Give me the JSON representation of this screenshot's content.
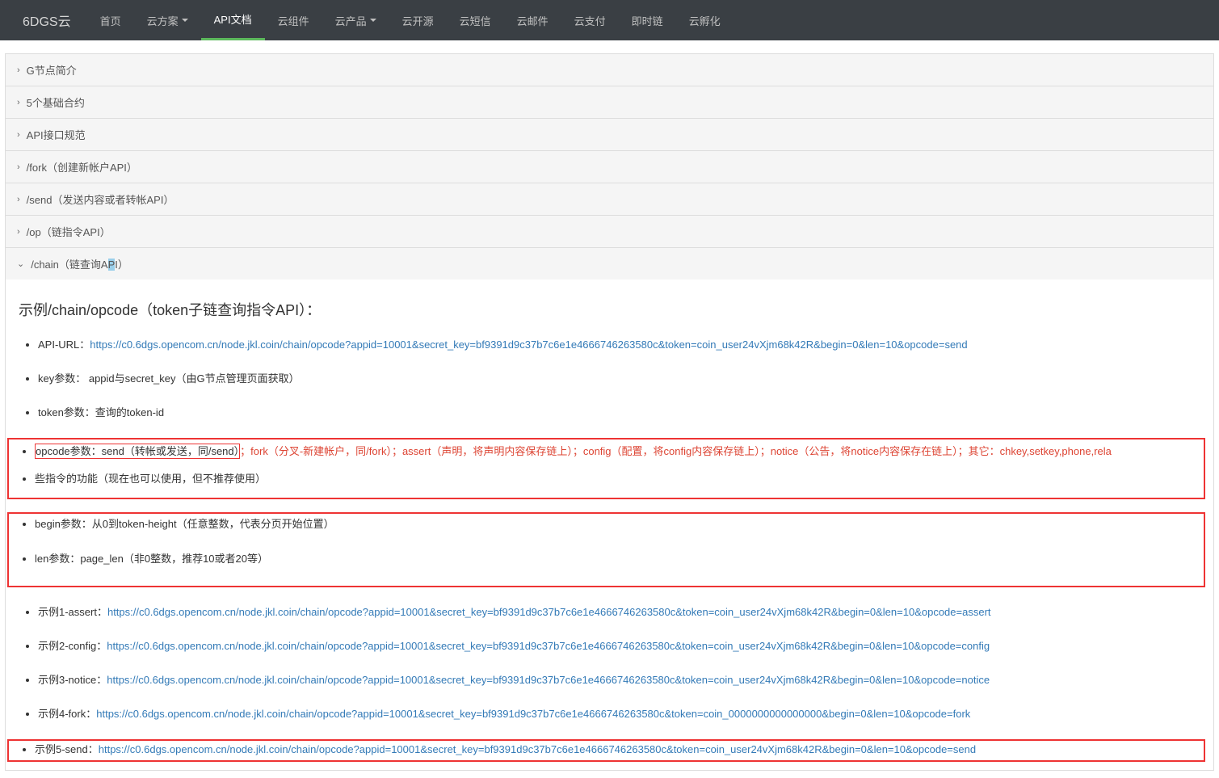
{
  "nav": {
    "brand": "6DGS云",
    "items": [
      {
        "label": "首页",
        "caret": false,
        "active": false
      },
      {
        "label": "云方案",
        "caret": true,
        "active": false
      },
      {
        "label": "API文档",
        "caret": false,
        "active": true
      },
      {
        "label": "云组件",
        "caret": false,
        "active": false
      },
      {
        "label": "云产品",
        "caret": true,
        "active": false
      },
      {
        "label": "云开源",
        "caret": false,
        "active": false
      },
      {
        "label": "云短信",
        "caret": false,
        "active": false
      },
      {
        "label": "云邮件",
        "caret": false,
        "active": false
      },
      {
        "label": "云支付",
        "caret": false,
        "active": false
      },
      {
        "label": "即时链",
        "caret": false,
        "active": false
      },
      {
        "label": "云孵化",
        "caret": false,
        "active": false
      }
    ]
  },
  "panels": [
    {
      "label": "G节点简介"
    },
    {
      "label": "5个基础合约"
    },
    {
      "label": "API接口规范"
    },
    {
      "label": "/fork（创建新帐户API）"
    },
    {
      "label": "/send（发送内容或者转帐API）"
    },
    {
      "label": "/op（链指令API）"
    }
  ],
  "openPanel": {
    "prefix": "/chain（链查询A",
    "hl": "P",
    "suffix": "I）"
  },
  "body": {
    "heading": "示例/chain/opcode（token子链查询指令API）：",
    "li1_a": "API-URL：",
    "li1_link": "https://c0.6dgs.opencom.cn/node.jkl.coin/chain/opcode?appid=10001&secret_key=bf9391d9c37b7c6e1e4666746263580c&token=coin_user24vXjm68k42R&begin=0&len=10&opcode=send",
    "li2": "key参数：  appid与secret_key（由G节点管理页面获取）",
    "li3": "token参数：查询的token-id",
    "red_l1": "opcode参数：send（转帐或发送，同/send）",
    "red_l1b": "；fork（分叉-新建帐户，同/fork）；assert（声明，将声明内容保存链上）；config（配置，将config内容保存链上）；notice（公告，将notice内容保存在链上）；其它：chkey,setkey,phone,rela",
    "red_l2": "些指令的功能（现在也可以使用，但不推荐使用）",
    "li5": "begin参数：从0到token-height（任意整数，代表分页开始位置）",
    "li6": "len参数：page_len（非0整数，推荐10或者20等）",
    "ex1_a": "示例1-assert：",
    "ex1_link": "https://c0.6dgs.opencom.cn/node.jkl.coin/chain/opcode?appid=10001&secret_key=bf9391d9c37b7c6e1e4666746263580c&token=coin_user24vXjm68k42R&begin=0&len=10&opcode=assert",
    "ex2_a": "示例2-config：",
    "ex2_link": "https://c0.6dgs.opencom.cn/node.jkl.coin/chain/opcode?appid=10001&secret_key=bf9391d9c37b7c6e1e4666746263580c&token=coin_user24vXjm68k42R&begin=0&len=10&opcode=config",
    "ex3_a": "示例3-notice：",
    "ex3_link": "https://c0.6dgs.opencom.cn/node.jkl.coin/chain/opcode?appid=10001&secret_key=bf9391d9c37b7c6e1e4666746263580c&token=coin_user24vXjm68k42R&begin=0&len=10&opcode=notice",
    "ex4_a": "示例4-fork：",
    "ex4_link": "https://c0.6dgs.opencom.cn/node.jkl.coin/chain/opcode?appid=10001&secret_key=bf9391d9c37b7c6e1e4666746263580c&token=coin_0000000000000000&begin=0&len=10&opcode=fork",
    "ex5_a": "示例5-send：",
    "ex5_link": "https://c0.6dgs.opencom.cn/node.jkl.coin/chain/opcode?appid=10001&secret_key=bf9391d9c37b7c6e1e4666746263580c&token=coin_user24vXjm68k42R&begin=0&len=10&opcode=send"
  }
}
